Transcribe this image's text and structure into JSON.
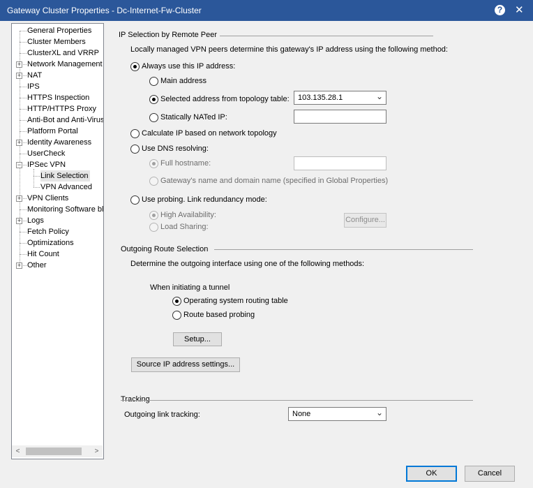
{
  "window": {
    "title": "Gateway Cluster Properties - Dc-Internet-Fw-Cluster",
    "help_icon": "?",
    "close_icon": "✕"
  },
  "tree": {
    "items": [
      {
        "label": "General Properties",
        "expandable": false
      },
      {
        "label": "Cluster Members",
        "expandable": false
      },
      {
        "label": "ClusterXL and VRRP",
        "expandable": false
      },
      {
        "label": "Network Management",
        "expandable": true
      },
      {
        "label": "NAT",
        "expandable": true
      },
      {
        "label": "IPS",
        "expandable": false
      },
      {
        "label": "HTTPS Inspection",
        "expandable": false
      },
      {
        "label": "HTTP/HTTPS Proxy",
        "expandable": false
      },
      {
        "label": "Anti-Bot and Anti-Virus",
        "expandable": false
      },
      {
        "label": "Platform Portal",
        "expandable": false
      },
      {
        "label": "Identity Awareness",
        "expandable": true
      },
      {
        "label": "UserCheck",
        "expandable": false
      },
      {
        "label": "IPSec VPN",
        "expandable": true,
        "expanded": true
      },
      {
        "label": "Link Selection",
        "child": true,
        "selected": true
      },
      {
        "label": "VPN Advanced",
        "child": true
      },
      {
        "label": "VPN Clients",
        "expandable": true
      },
      {
        "label": "Monitoring Software bla",
        "expandable": false
      },
      {
        "label": "Logs",
        "expandable": true
      },
      {
        "label": "Fetch Policy",
        "expandable": false
      },
      {
        "label": "Optimizations",
        "expandable": false
      },
      {
        "label": "Hit Count",
        "expandable": false
      },
      {
        "label": "Other",
        "expandable": true
      }
    ],
    "scroll_left": "<",
    "scroll_right": ">"
  },
  "ip_selection": {
    "header": "IP Selection by Remote Peer",
    "description": "Locally managed VPN peers determine this gateway's IP address using the following method:",
    "always_use": "Always use this IP address:",
    "main_address": "Main address",
    "selected_from_topology": "Selected address from topology table:",
    "topology_value": "103.135.28.1",
    "statically_nated": "Statically NATed IP:",
    "calculate": "Calculate IP based on network topology",
    "use_dns": "Use DNS resolving:",
    "full_hostname": "Full hostname:",
    "gateway_name": "Gateway's name and domain name (specified in Global Properties)",
    "use_probing": "Use probing. Link redundancy mode:",
    "high_availability": "High Availability:",
    "load_sharing": "Load Sharing:",
    "configure": "Configure..."
  },
  "outgoing": {
    "header": "Outgoing Route Selection",
    "description": "Determine the outgoing interface using one of the following methods:",
    "when_initiating": "When initiating a tunnel",
    "os_routing": "Operating system routing table",
    "route_probing": "Route based probing",
    "setup": "Setup...",
    "source_ip": "Source IP address settings..."
  },
  "tracking": {
    "header": "Tracking",
    "outgoing_label": "Outgoing link tracking:",
    "value": "None"
  },
  "footer": {
    "ok": "OK",
    "cancel": "Cancel"
  }
}
